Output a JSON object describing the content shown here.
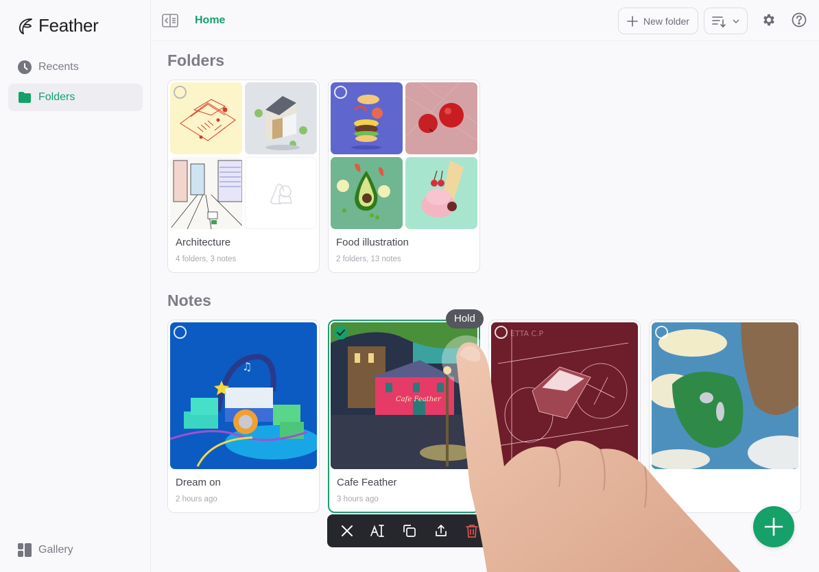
{
  "app": {
    "name": "Feather"
  },
  "sidebar": {
    "items": [
      {
        "label": "Recents",
        "icon": "clock-icon",
        "active": false
      },
      {
        "label": "Folders",
        "icon": "folder-icon",
        "active": true
      }
    ],
    "footer": {
      "label": "Gallery",
      "icon": "gallery-icon"
    }
  },
  "topbar": {
    "breadcrumb": "Home",
    "new_folder_label": "New folder",
    "sort_icon": "sort-icon",
    "settings_icon": "gear-icon",
    "help_icon": "help-icon"
  },
  "folders": {
    "title": "Folders",
    "items": [
      {
        "name": "Architecture",
        "meta": "4 folders, 3 notes",
        "thumbnails": [
          "isometric-red-sketch",
          "grey-house-illustration",
          "city-street-sketch",
          "empty-placeholder"
        ]
      },
      {
        "name": "Food illustration",
        "meta": "2 folders, 13 notes",
        "thumbnails": [
          "burger-on-purple",
          "apples-on-pink",
          "avocado-on-green",
          "ice-cream-on-mint"
        ]
      }
    ]
  },
  "notes": {
    "title": "Notes",
    "items": [
      {
        "name": "Dream on",
        "meta": "2 hours ago",
        "selected": false,
        "thumbnail": "headphones-cassettes-blue"
      },
      {
        "name": "Cafe Feather",
        "meta": "3 hours ago",
        "selected": true,
        "thumbnail": "night-cafe-street"
      },
      {
        "name": "",
        "meta": "",
        "selected": false,
        "thumbnail": "motorbike-blueprint-red"
      },
      {
        "name": "",
        "meta": "",
        "selected": false,
        "thumbnail": "floating-island-sky"
      }
    ]
  },
  "tooltip": {
    "label": "Hold"
  },
  "action_bar": {
    "actions": [
      {
        "name": "close",
        "icon": "close-icon"
      },
      {
        "name": "rename",
        "icon": "rename-icon"
      },
      {
        "name": "duplicate",
        "icon": "duplicate-icon"
      },
      {
        "name": "share",
        "icon": "share-icon"
      },
      {
        "name": "delete",
        "icon": "trash-icon"
      }
    ]
  },
  "fab": {
    "icon": "plus-icon"
  },
  "colors": {
    "accent": "#16a06a",
    "background": "#f9f9fb",
    "action_bar": "#26272c",
    "delete": "#d9534f"
  }
}
